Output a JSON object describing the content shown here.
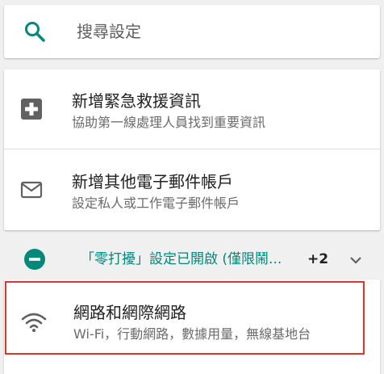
{
  "search": {
    "placeholder": "搜尋設定",
    "icon": "search-icon"
  },
  "suggestions": [
    {
      "title": "新增緊急救援資訊",
      "subtitle": "協助第一線處理人員找到重要資訊",
      "icon": "medical-plus-icon"
    },
    {
      "title": "新增其他電子郵件帳戶",
      "subtitle": "設定私人或工作電子郵件帳戶",
      "icon": "email-icon"
    }
  ],
  "condition": {
    "text": "「零打擾」設定已開啟 (僅限鬧...",
    "count": "+2",
    "icon": "do-not-disturb-icon"
  },
  "network": {
    "title": "網路和網際網路",
    "subtitle": "Wi-Fi，行動網路，數據用量，無線基地台",
    "icon": "wifi-icon"
  },
  "colors": {
    "accent": "#00897b",
    "highlight": "#e2352a",
    "background": "#f0f0f0"
  }
}
